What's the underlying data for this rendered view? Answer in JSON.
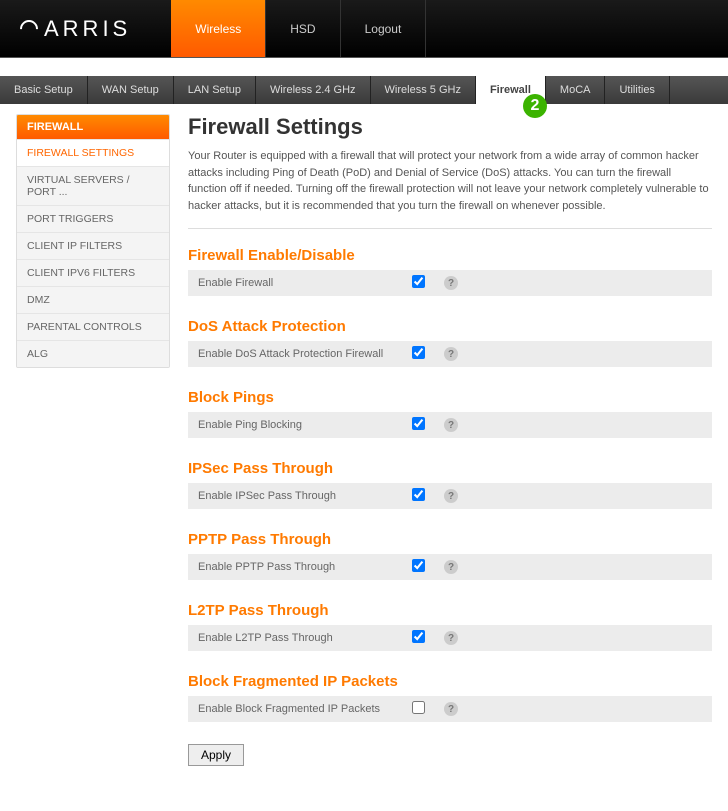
{
  "brand": "ARRIS",
  "topnav": [
    {
      "label": "Wireless",
      "active": true
    },
    {
      "label": "HSD",
      "active": false
    },
    {
      "label": "Logout",
      "active": false
    }
  ],
  "tabs": [
    {
      "label": "Basic Setup"
    },
    {
      "label": "WAN Setup"
    },
    {
      "label": "LAN Setup"
    },
    {
      "label": "Wireless 2.4 GHz"
    },
    {
      "label": "Wireless 5 GHz"
    },
    {
      "label": "Firewall",
      "active": true,
      "badge": "2"
    },
    {
      "label": "MoCA"
    },
    {
      "label": "Utilities"
    }
  ],
  "sidebar": {
    "heading": "FIREWALL",
    "items": [
      {
        "label": "FIREWALL SETTINGS",
        "selected": true
      },
      {
        "label": "VIRTUAL SERVERS / PORT ..."
      },
      {
        "label": "PORT TRIGGERS"
      },
      {
        "label": "CLIENT IP FILTERS"
      },
      {
        "label": "CLIENT IPV6 FILTERS"
      },
      {
        "label": "DMZ"
      },
      {
        "label": "PARENTAL CONTROLS"
      },
      {
        "label": "ALG"
      }
    ]
  },
  "page": {
    "title": "Firewall Settings",
    "description": "Your Router is equipped with a firewall that will protect your network from a wide array of common hacker attacks including Ping of Death (PoD) and Denial of Service (DoS) attacks. You can turn the firewall function off if needed. Turning off the firewall protection will not leave your network completely vulnerable to hacker attacks, but it is recommended that you turn the firewall on whenever possible.",
    "sections": [
      {
        "title": "Firewall Enable/Disable",
        "label": "Enable Firewall",
        "checked": true
      },
      {
        "title": "DoS Attack Protection",
        "label": "Enable DoS Attack Protection Firewall",
        "checked": true
      },
      {
        "title": "Block Pings",
        "label": "Enable Ping Blocking",
        "checked": true
      },
      {
        "title": "IPSec Pass Through",
        "label": "Enable IPSec Pass Through",
        "checked": true
      },
      {
        "title": "PPTP Pass Through",
        "label": "Enable PPTP Pass Through",
        "checked": true
      },
      {
        "title": "L2TP Pass Through",
        "label": "Enable L2TP Pass Through",
        "checked": true
      },
      {
        "title": "Block Fragmented IP Packets",
        "label": "Enable Block Fragmented IP Packets",
        "checked": false
      }
    ],
    "apply": "Apply"
  }
}
